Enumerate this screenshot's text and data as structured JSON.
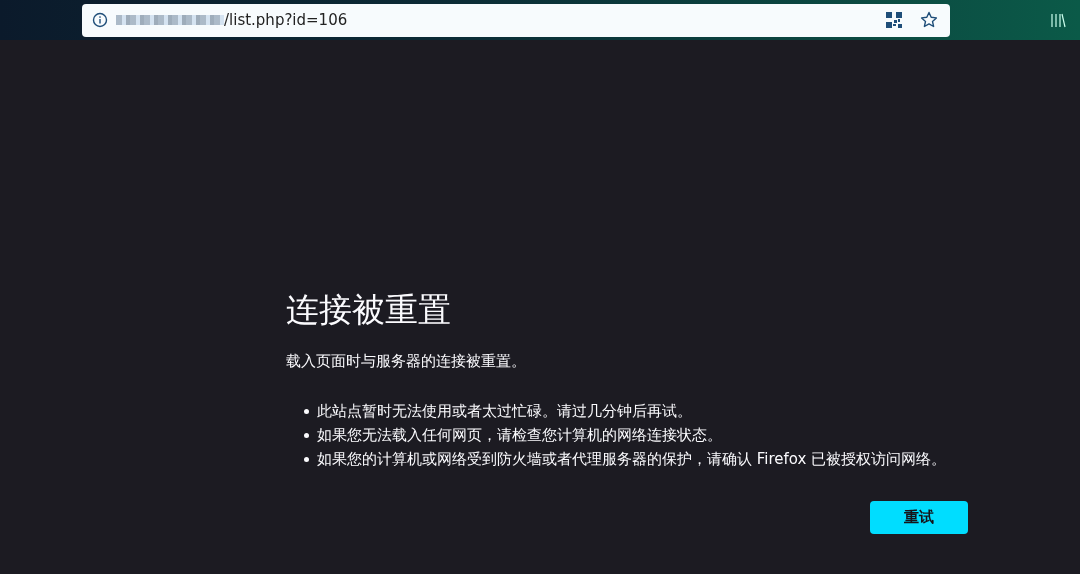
{
  "address_bar": {
    "url": "/list.php?id=106"
  },
  "error": {
    "title": "连接被重置",
    "description": "载入页面时与服务器的连接被重置。",
    "suggestions": [
      "此站点暂时无法使用或者太过忙碌。请过几分钟后再试。",
      "如果您无法载入任何网页，请检查您计算机的网络连接状态。",
      "如果您的计算机或网络受到防火墙或者代理服务器的保护，请确认 Firefox 已被授权访问网络。"
    ],
    "button": "重试"
  }
}
